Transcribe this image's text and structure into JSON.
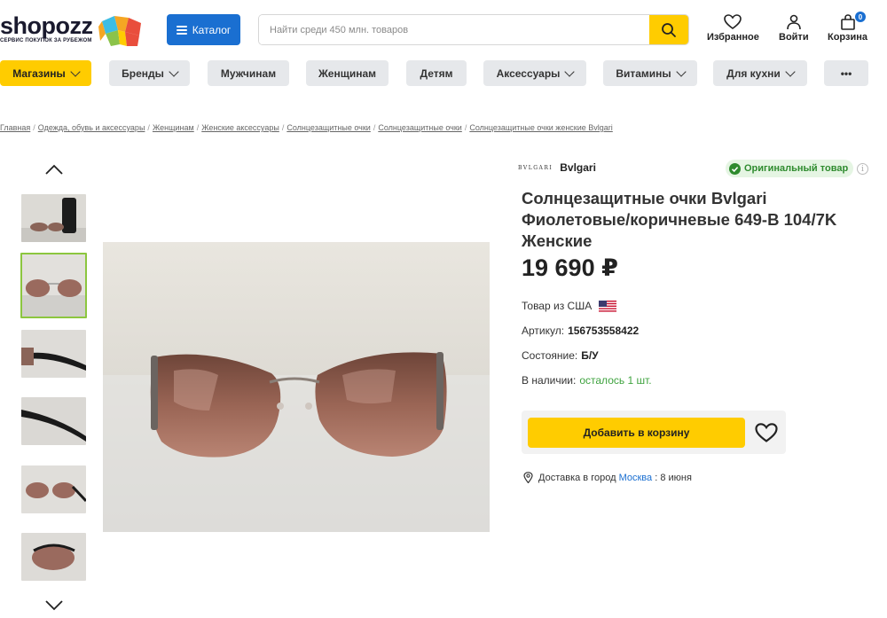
{
  "header": {
    "logo_text": "shopozz",
    "logo_sub": "СЕРВИС ПОКУПОК ЗА РУБЕЖОМ",
    "catalog_label": "Каталог",
    "search_placeholder": "Найти среди 450 млн. товаров",
    "favorites_label": "Избранное",
    "login_label": "Войти",
    "cart_label": "Корзина",
    "cart_count": "0"
  },
  "nav": {
    "items": [
      {
        "label": "Магазины"
      },
      {
        "label": "Бренды"
      },
      {
        "label": "Мужчинам"
      },
      {
        "label": "Женщинам"
      },
      {
        "label": "Детям"
      },
      {
        "label": "Аксессуары"
      },
      {
        "label": "Витамины"
      },
      {
        "label": "Для кухни"
      },
      {
        "label": "•••"
      }
    ]
  },
  "breadcrumb": [
    "Главная",
    "Одежда, обувь и аксессуары",
    "Женщинам",
    "Женские аксессуары",
    "Солнцезащитные очки",
    "Солнцезащитные очки",
    "Солнцезащитные очки женские Bvlgari"
  ],
  "breadcrumb_sep": "/",
  "product": {
    "brand_logo": "BVLGARI",
    "brand": "Bvlgari",
    "original_label": "Оригинальный товар",
    "info_symbol": "i",
    "title": "Солнцезащитные очки Bvlgari Фиолетовые/коричневые 649-B 104/7K Женские",
    "price": "19 690 ₽",
    "origin_label": "Товар из США",
    "sku_label": "Артикул:",
    "sku": "156753558422",
    "condition_label": "Состояние:",
    "condition": "Б/У",
    "stock_label": "В наличии:",
    "stock": "осталось 1 шт.",
    "add_to_cart": "Добавить в корзину",
    "delivery_label": "Доставка в город",
    "delivery_city": "Москва",
    "delivery_sep": ":",
    "delivery_date": "8 июня"
  },
  "colors": {
    "accent_yellow": "#ffcc00",
    "brand_blue": "#1a6fd1",
    "original_green": "#2e8b2e",
    "lens_brown": "#8a5a4a"
  }
}
